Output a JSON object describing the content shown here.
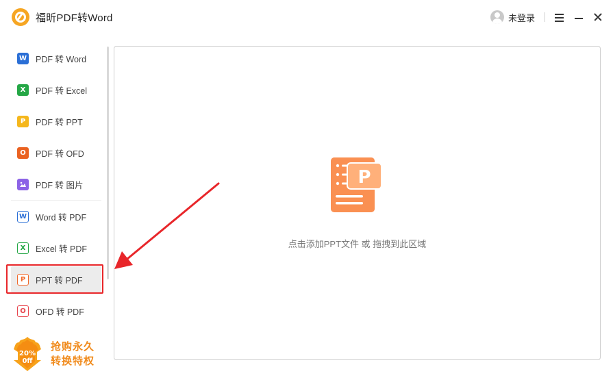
{
  "app": {
    "title": "福昕PDF转Word"
  },
  "user": {
    "login_label": "未登录"
  },
  "sidebar": {
    "items": [
      {
        "label": "PDF 转 Word",
        "icon": "word-icon",
        "glyph": "W",
        "color": "#2b6fd6",
        "style": "solid",
        "active": false
      },
      {
        "label": "PDF 转 Excel",
        "icon": "excel-icon",
        "glyph": "X",
        "color": "#25a746",
        "style": "solid",
        "active": false
      },
      {
        "label": "PDF 转 PPT",
        "icon": "ppt-icon",
        "glyph": "P",
        "color": "#f5b71c",
        "style": "solid",
        "active": false
      },
      {
        "label": "PDF 转 OFD",
        "icon": "ofd-icon",
        "glyph": "O",
        "color": "#ea6221",
        "style": "solid",
        "active": false
      },
      {
        "label": "PDF 转 图片",
        "icon": "image-icon",
        "glyph": "",
        "color": "#8c63e6",
        "style": "solid",
        "active": false
      },
      {
        "label": "Word 转 PDF",
        "icon": "word-doc-icon",
        "glyph": "W",
        "color": "#2b6fd6",
        "style": "outline",
        "active": false
      },
      {
        "label": "Excel 转 PDF",
        "icon": "excel-doc-icon",
        "glyph": "X",
        "color": "#25a746",
        "style": "outline",
        "active": false
      },
      {
        "label": "PPT 转 PDF",
        "icon": "ppt-doc-icon",
        "glyph": "P",
        "color": "#f06a2c",
        "style": "outline",
        "active": true
      },
      {
        "label": "OFD 转 PDF",
        "icon": "ofd-doc-icon",
        "glyph": "O",
        "color": "#e8474f",
        "style": "outline",
        "active": false
      }
    ]
  },
  "promo": {
    "badge_percent": "20%",
    "badge_off": "0ff",
    "line1": "抢购永久",
    "line2": "转换特权"
  },
  "main": {
    "drop_hint": "点击添加PPT文件 或 拖拽到此区域",
    "icon_glyph": "P"
  },
  "colors": {
    "accent_orange": "#f7894a",
    "highlight_red": "#e8262a",
    "promo_orange": "#f08a1b"
  }
}
